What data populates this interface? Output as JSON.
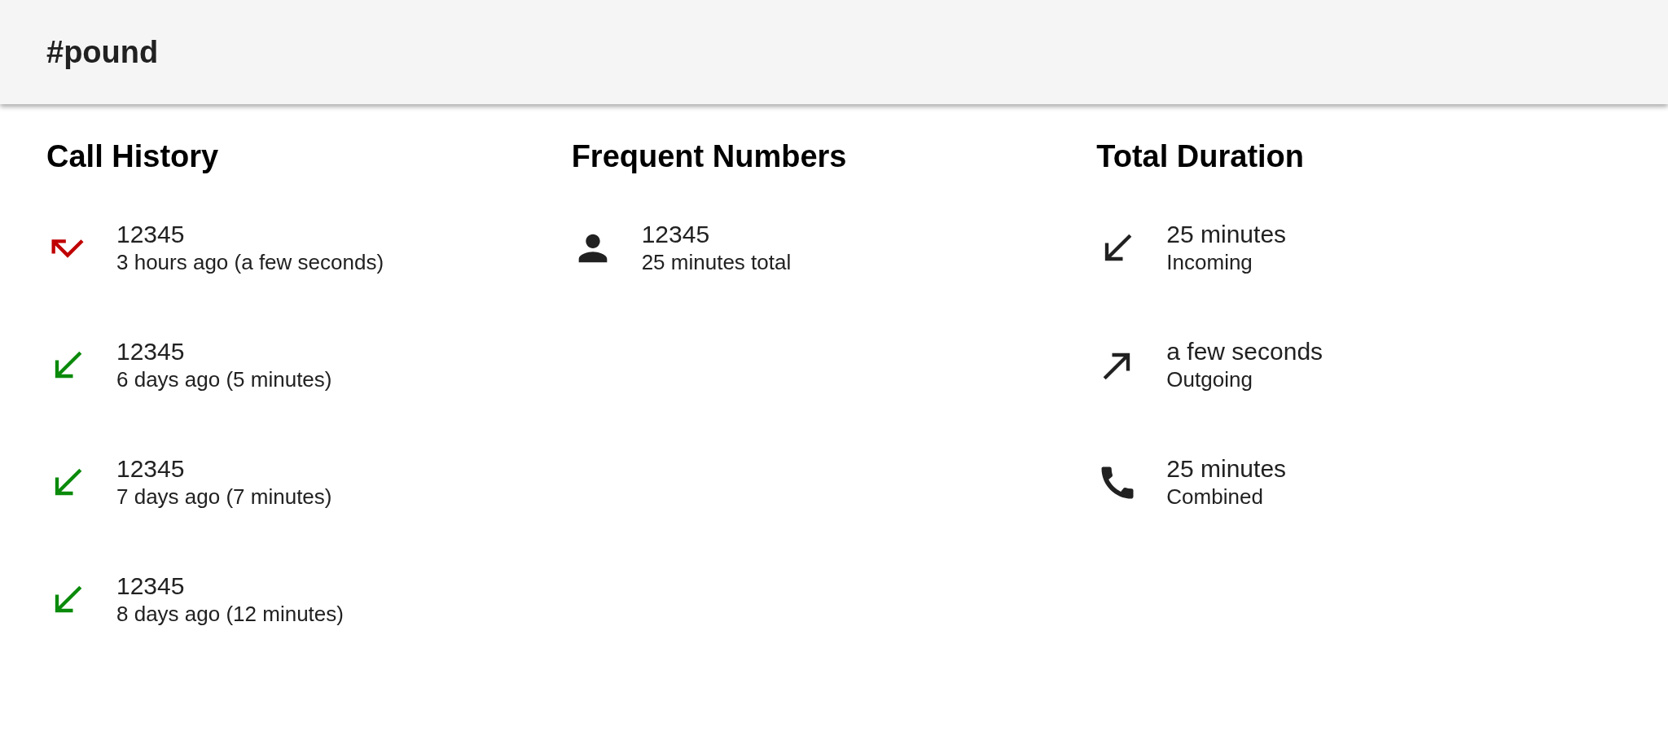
{
  "app_bar": {
    "title": "#pound"
  },
  "sections": [
    {
      "title": "Call History",
      "items": [
        {
          "kind": "missed",
          "primary": "12345",
          "secondary": "3 hours ago (a few seconds)"
        },
        {
          "kind": "incoming",
          "primary": "12345",
          "secondary": "6 days ago (5 minutes)"
        },
        {
          "kind": "incoming",
          "primary": "12345",
          "secondary": "7 days ago (7 minutes)"
        },
        {
          "kind": "incoming",
          "primary": "12345",
          "secondary": "8 days ago (12 minutes)"
        }
      ]
    },
    {
      "title": "Frequent Numbers",
      "items": [
        {
          "kind": "person",
          "primary": "12345",
          "secondary": "25 minutes total"
        }
      ]
    },
    {
      "title": "Total Duration",
      "items": [
        {
          "kind": "incoming_total",
          "primary": "25 minutes",
          "secondary": "Incoming"
        },
        {
          "kind": "outgoing_total",
          "primary": "a few seconds",
          "secondary": "Outgoing"
        },
        {
          "kind": "combined_total",
          "primary": "25 minutes",
          "secondary": "Combined"
        }
      ]
    }
  ]
}
